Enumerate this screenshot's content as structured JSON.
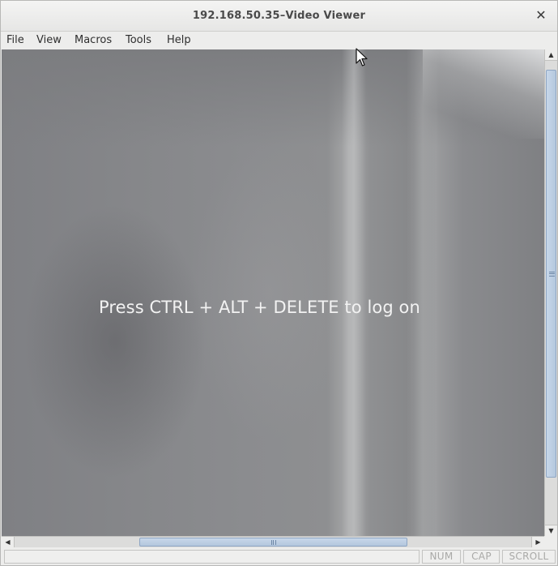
{
  "window": {
    "title": "192.168.50.35–Video Viewer"
  },
  "menu": {
    "items": [
      "File",
      "View",
      "Macros",
      "Tools",
      "Help"
    ]
  },
  "viewport": {
    "message": "Press CTRL + ALT + DELETE to log on"
  },
  "scroll": {
    "vertical_position": 0.16,
    "vertical_visible_fraction": 0.88,
    "horizontal_position": 0.5,
    "horizontal_visible_fraction": 0.52
  },
  "status": {
    "indicators": [
      "NUM",
      "CAP",
      "SCROLL"
    ]
  },
  "icons": {
    "close": "close-icon",
    "cursor": "mouse-pointer-icon"
  },
  "colors": {
    "scroll_thumb": "#b4c7dd",
    "indicator_text": "#a9a9a7"
  }
}
